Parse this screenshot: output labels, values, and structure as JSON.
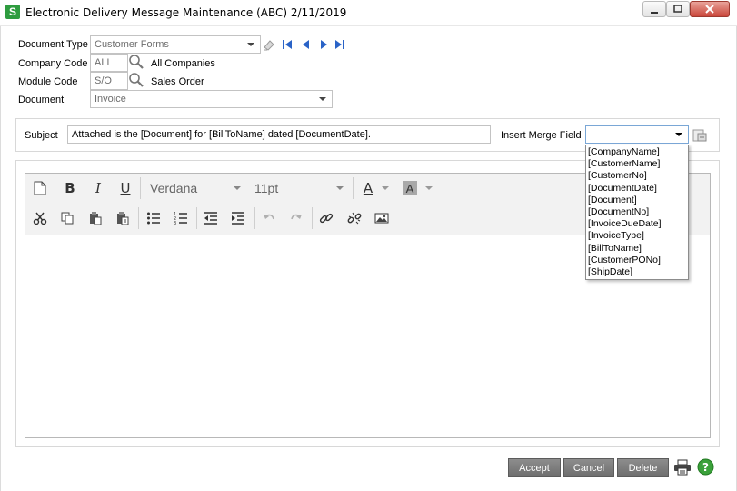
{
  "window": {
    "title": "Electronic Delivery Message Maintenance (ABC) 2/11/2019",
    "app_icon_letter": "S"
  },
  "form": {
    "document_type": {
      "label": "Document Type",
      "value": "Customer Forms"
    },
    "company_code": {
      "label": "Company Code",
      "value": "ALL",
      "description": "All Companies"
    },
    "module_code": {
      "label": "Module Code",
      "value": "S/O",
      "description": "Sales Order"
    },
    "document": {
      "label": "Document",
      "value": "Invoice"
    }
  },
  "subject": {
    "label": "Subject",
    "value": "Attached is the [Document] for [BillToName] dated [DocumentDate]."
  },
  "merge": {
    "label": "Insert Merge Field",
    "value": "",
    "options": [
      "[CompanyName]",
      "[CustomerName]",
      "[CustomerNo]",
      "[DocumentDate]",
      "[Document]",
      "[DocumentNo]",
      "[InvoiceDueDate]",
      "[InvoiceType]",
      "[BillToName]",
      "[CustomerPONo]",
      "[ShipDate]"
    ]
  },
  "editor_toolbar": {
    "font": "Verdana",
    "size": "11pt",
    "bold": "B",
    "italic": "I",
    "underline": "U",
    "font_color": "A",
    "highlight": "A"
  },
  "buttons": {
    "accept": "Accept",
    "cancel": "Cancel",
    "delete": "Delete"
  },
  "colors": {
    "nav_blue": "#2a63c7",
    "app_green": "#2e9c3f",
    "button_gray": "#7b7b7b",
    "help_green": "#3aa13a"
  }
}
